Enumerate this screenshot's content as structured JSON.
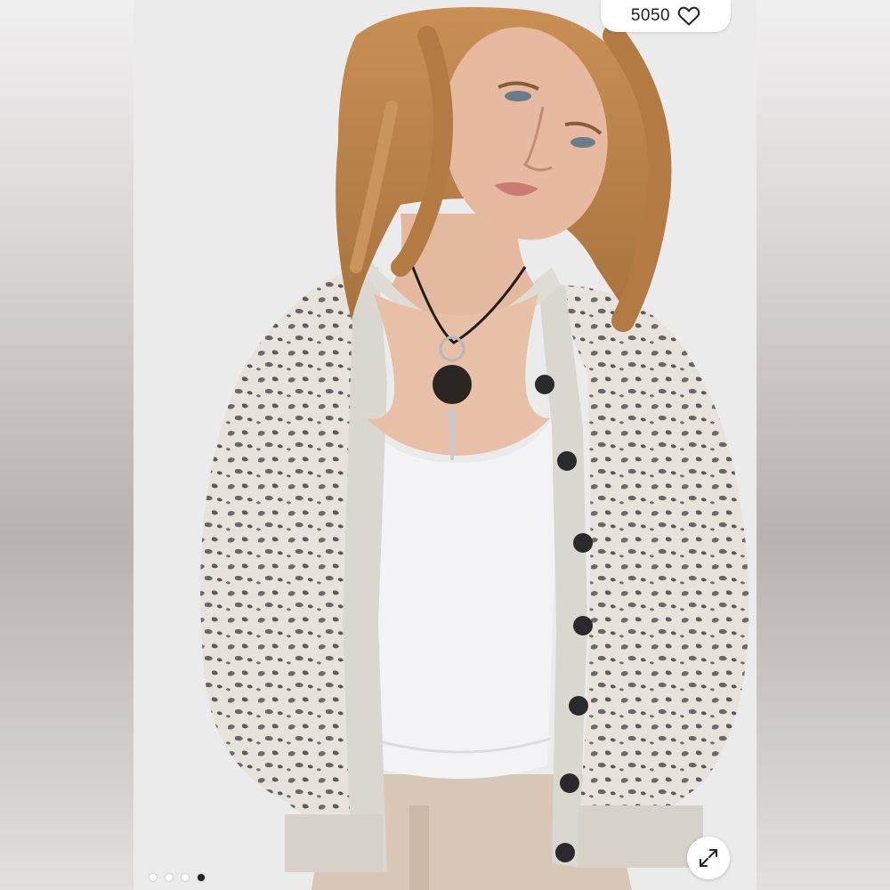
{
  "listing": {
    "like_count": "5050",
    "like_icon": "heart-outline-icon",
    "expand_icon": "expand-arrows-icon",
    "image_count": 4,
    "active_image_index": 3
  },
  "colors": {
    "background_blur": "#d9d6d6",
    "pill_bg": "#ffffff",
    "dot_inactive": "#ffffff",
    "dot_active": "#222222"
  }
}
